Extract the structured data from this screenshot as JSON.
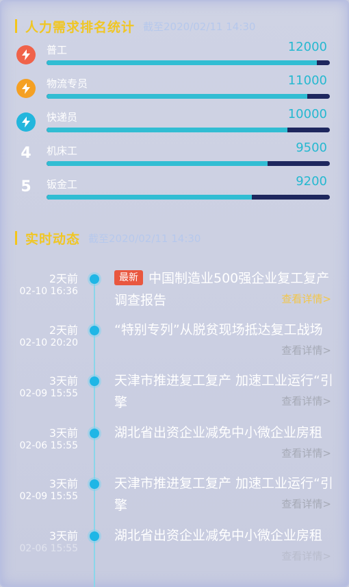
{
  "ranking": {
    "title": "人力需求排名统计",
    "subtitle": "截至2020/02/11 14:30",
    "items": [
      {
        "rank": "1",
        "name": "普工",
        "value": "12000",
        "fill": 0.955,
        "icon": "bolt-icon",
        "color": "#f0624a"
      },
      {
        "rank": "2",
        "name": "物流专员",
        "value": "11000",
        "fill": 0.92,
        "icon": "bolt-icon",
        "color": "#f5a023"
      },
      {
        "rank": "3",
        "name": "快递员",
        "value": "10000",
        "fill": 0.85,
        "icon": "bolt-icon",
        "color": "#23b6dd"
      },
      {
        "rank": "4",
        "name": "机床工",
        "value": "9500",
        "fill": 0.78,
        "icon": "",
        "color": ""
      },
      {
        "rank": "5",
        "name": "钣金工",
        "value": "9200",
        "fill": 0.725,
        "icon": "",
        "color": ""
      }
    ]
  },
  "timeline": {
    "title": "实时动态",
    "subtitle": "截至2020/02/11 14:30",
    "more_label": "查看详情>",
    "items": [
      {
        "when": "2天前",
        "date": "02-10 16:36",
        "tag": "最新",
        "title": "中国制造业500强企业复工复产调查报告"
      },
      {
        "when": "2天前",
        "date": "02-10 20:20",
        "tag": "",
        "title": "“特别专列”从脱贫现场抵达复工战场"
      },
      {
        "when": "3天前",
        "date": "02-09 15:55",
        "tag": "",
        "title": "天津市推进复工复产 加速工业运行“引擎"
      },
      {
        "when": "3天前",
        "date": "02-06 15:55",
        "tag": "",
        "title": "湖北省出资企业减免中小微企业房租"
      },
      {
        "when": "3天前",
        "date": "02-09 15:55",
        "tag": "",
        "title": "天津市推进复工复产 加速工业运行“引擎"
      },
      {
        "when": "3天前",
        "date": "02-06 15:55",
        "tag": "",
        "title": "湖北省出资企业减免中小微企业房租"
      }
    ]
  }
}
